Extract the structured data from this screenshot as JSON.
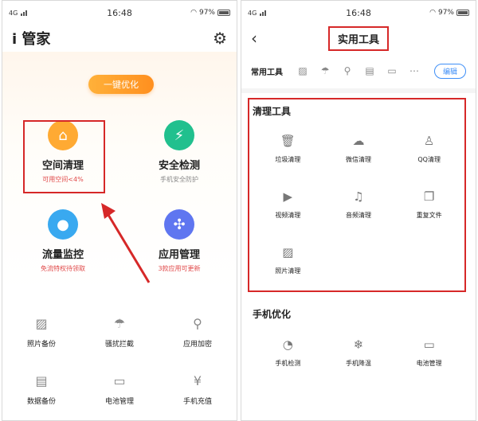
{
  "status_left": {
    "network": "4G",
    "time": "16:48",
    "battery": "97%"
  },
  "status_right": {
    "network": "4G",
    "time": "16:48",
    "battery": "97%"
  },
  "left": {
    "app_title": "i 管家",
    "optimize_label": "一键优化",
    "tiles": [
      {
        "title": "空间清理",
        "subtitle": "可用空间<4%",
        "color": "#ffaa33",
        "subcolor": "#e04a4a",
        "icon": "broom-icon",
        "glyph": "⌂"
      },
      {
        "title": "安全检测",
        "subtitle": "手机安全防护",
        "color": "#21c08e",
        "subcolor": "#888888",
        "icon": "shield-icon",
        "glyph": "⚡"
      },
      {
        "title": "流量监控",
        "subtitle": "免流特权待领取",
        "color": "#39a9f0",
        "subcolor": "#e04a4a",
        "icon": "water-drop-icon",
        "glyph": "💧"
      },
      {
        "title": "应用管理",
        "subtitle": "3款应用可更新",
        "color": "#5f76f0",
        "subcolor": "#e04a4a",
        "icon": "app-grid-icon",
        "glyph": "✣"
      }
    ],
    "tools": [
      {
        "label": "照片备份",
        "icon": "photo-icon",
        "glyph": "▨"
      },
      {
        "label": "骚扰拦截",
        "icon": "umbrella-icon",
        "glyph": "☂"
      },
      {
        "label": "应用加密",
        "icon": "lock-key-icon",
        "glyph": "⚲"
      },
      {
        "label": "数据备份",
        "icon": "database-icon",
        "glyph": "▤"
      },
      {
        "label": "电池管理",
        "icon": "battery-icon",
        "glyph": "▭"
      },
      {
        "label": "手机充值",
        "icon": "phone-yen-icon",
        "glyph": "¥"
      }
    ]
  },
  "right": {
    "page_title": "实用工具",
    "common_label": "常用工具",
    "edit_label": "编辑",
    "common_icons": [
      "photo-icon",
      "umbrella-icon",
      "lock-key-icon",
      "database-icon",
      "battery-icon",
      "more-icon"
    ],
    "clean_section": "清理工具",
    "clean_items": [
      {
        "label": "垃圾清理",
        "icon": "trash-icon",
        "glyph": "🗑"
      },
      {
        "label": "微信清理",
        "icon": "wechat-icon",
        "glyph": "☁"
      },
      {
        "label": "QQ清理",
        "icon": "qq-icon",
        "glyph": "♙"
      },
      {
        "label": "视频清理",
        "icon": "video-icon",
        "glyph": "▶"
      },
      {
        "label": "音频清理",
        "icon": "music-icon",
        "glyph": "♫"
      },
      {
        "label": "重复文件",
        "icon": "duplicate-file-icon",
        "glyph": "❐"
      },
      {
        "label": "照片清理",
        "icon": "photo-icon",
        "glyph": "▨"
      }
    ],
    "optimize_section": "手机优化",
    "optimize_items": [
      {
        "label": "手机检测",
        "icon": "phone-check-icon",
        "glyph": "◔"
      },
      {
        "label": "手机降温",
        "icon": "snowflake-icon",
        "glyph": "❄"
      },
      {
        "label": "电池管理",
        "icon": "battery-icon",
        "glyph": "▭"
      }
    ]
  }
}
